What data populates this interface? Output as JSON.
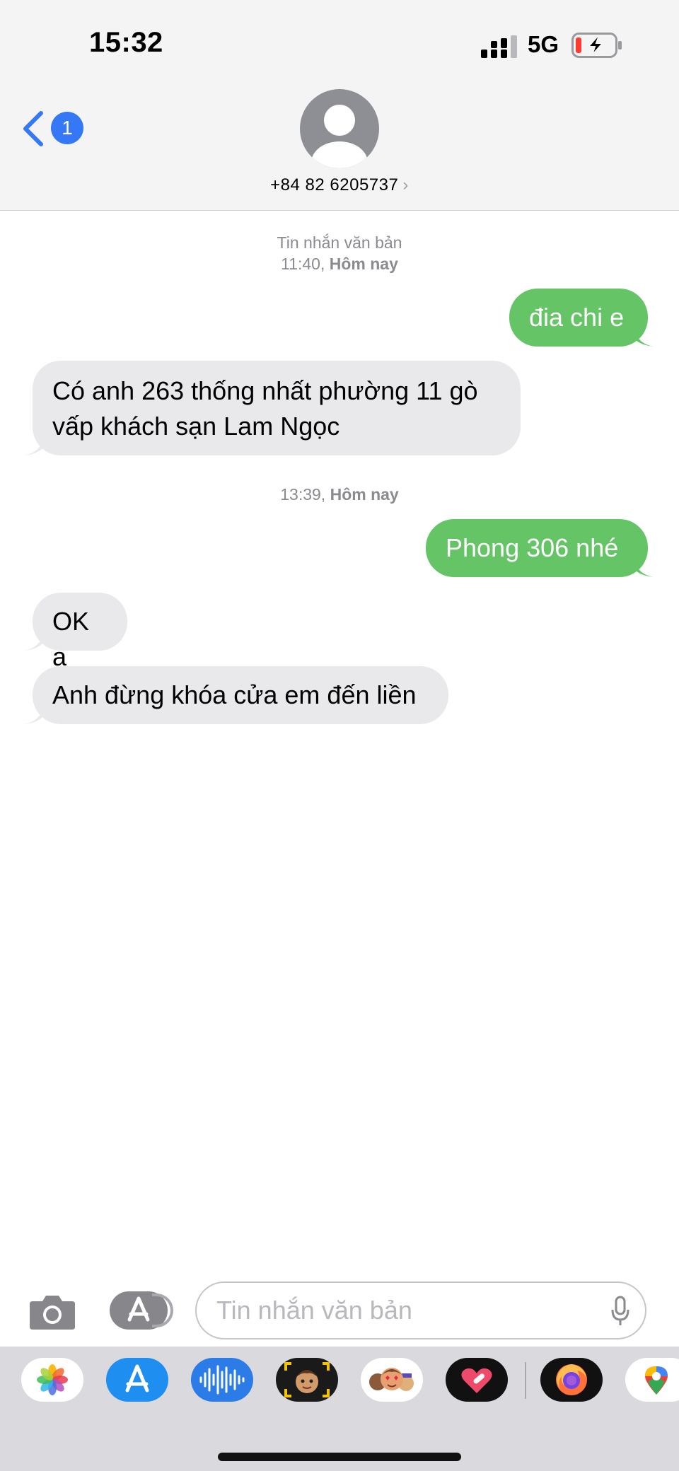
{
  "status_bar": {
    "time": "15:32",
    "network": "5G"
  },
  "header": {
    "back_badge": "1",
    "contact_number": "+84 82 6205737",
    "contact_chevron": "›"
  },
  "thread": {
    "type_label": "Tin nhắn văn bản",
    "stamp1_time": "11:40,",
    "stamp1_day": "Hôm nay",
    "stamp2_time": "13:39,",
    "stamp2_day": "Hôm nay",
    "messages": [
      {
        "direction": "outgoing",
        "text": "đia chi e"
      },
      {
        "direction": "incoming",
        "line1": "Có anh 263 thống nhất phường 11 gò",
        "line2": "vấp khách sạn Lam Ngọc"
      },
      {
        "direction": "outgoing",
        "text": "Phong 306 nhé"
      },
      {
        "direction": "incoming",
        "text": "OK a"
      },
      {
        "direction": "incoming",
        "text": "Anh đừng khóa cửa em đến liền"
      }
    ]
  },
  "composer": {
    "placeholder": "Tin nhắn văn bản"
  },
  "app_drawer": {
    "apps": [
      {
        "icon": "photos-icon"
      },
      {
        "icon": "app-store-icon"
      },
      {
        "icon": "audio-waveform-icon"
      },
      {
        "icon": "memoji-icon"
      },
      {
        "icon": "memoji-stickers-icon"
      },
      {
        "icon": "heart-digital-touch-icon"
      },
      {
        "icon": "firefox-icon"
      },
      {
        "icon": "maps-icon"
      }
    ]
  },
  "colors": {
    "outgoing_bubble": "#65c466",
    "incoming_bubble": "#e9e9eb",
    "accent_blue": "#3478f6",
    "header_bg": "#f4f4f4"
  }
}
